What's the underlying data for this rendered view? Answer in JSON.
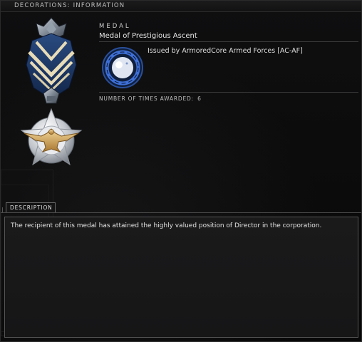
{
  "window": {
    "title": "DECORATIONS: INFORMATION"
  },
  "medal": {
    "section_label": "MEDAL",
    "name": "Medal of Prestigious Ascent",
    "issuer_text": "Issued by ArmoredCore Armed Forces [AC-AF]",
    "times_awarded_label": "NUMBER OF TIMES AWARDED:",
    "times_awarded_value": "6"
  },
  "tabs": [
    {
      "label": "DESCRIPTION",
      "active": true
    }
  ],
  "description": {
    "text": "The recipient of this medal has attained the highly valued position of Director in the corporation."
  },
  "icons": {
    "ribbon": "medal-ribbon-icon",
    "star_medal": "eagle-star-medal-icon",
    "issuer_logo": "corporation-logo-icon"
  },
  "colors": {
    "ribbon_blue": "#1f3d6e",
    "ribbon_cream": "#e8dcb8",
    "medal_silver": "#c9ccd1",
    "medal_gold": "#d4a657",
    "logo_blue": "#3d6fd6"
  }
}
